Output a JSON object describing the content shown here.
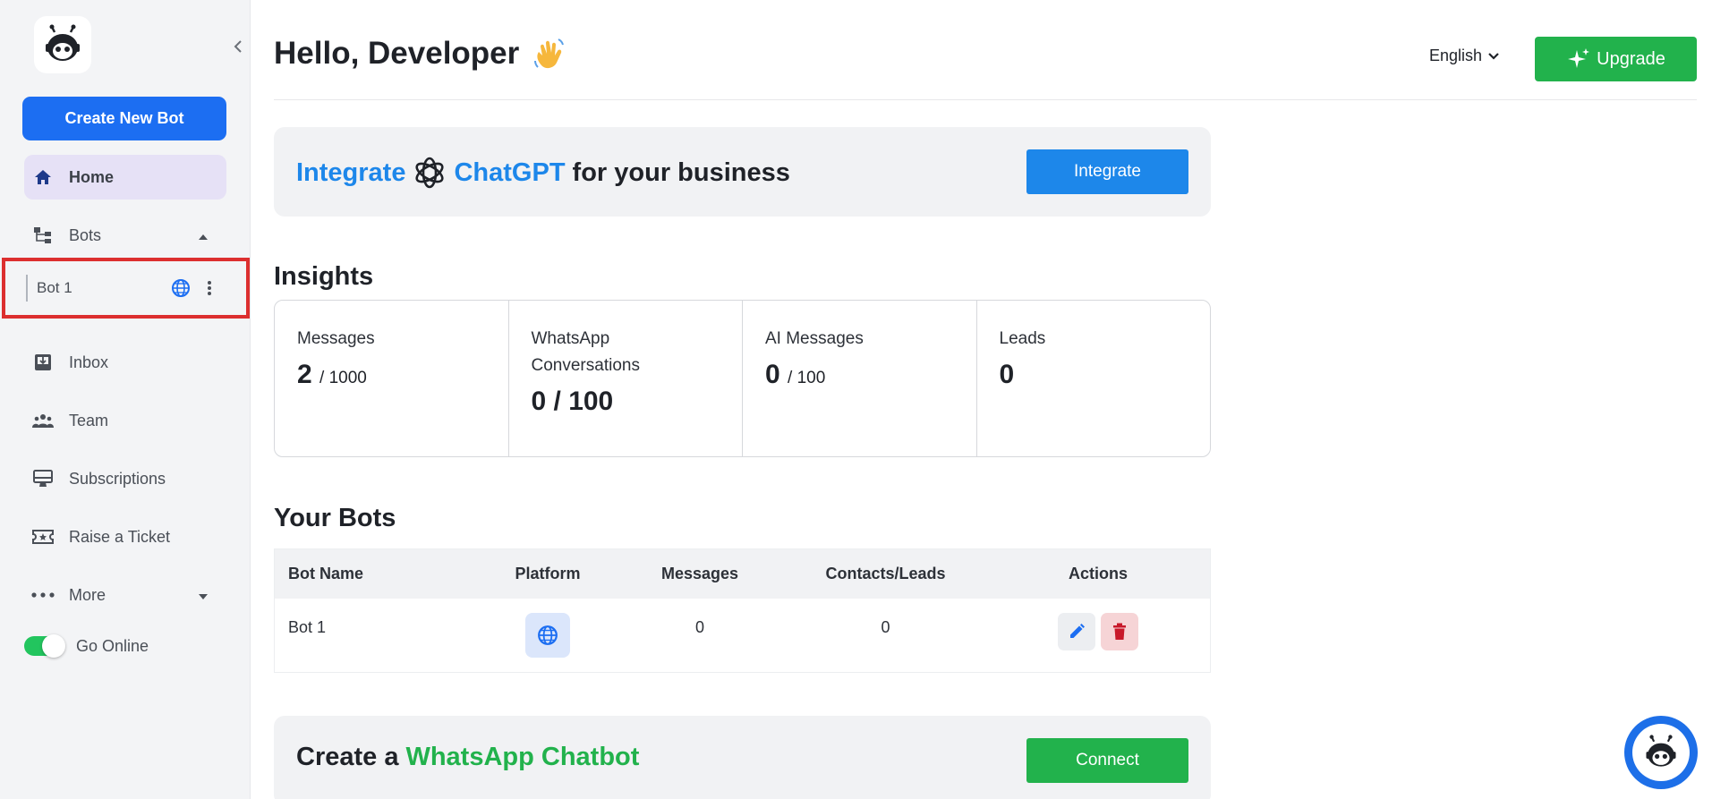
{
  "sidebar": {
    "create_label": "Create New Bot",
    "items": [
      {
        "label": "Home",
        "icon": "home-icon"
      },
      {
        "label": "Bots",
        "icon": "bots-icon"
      },
      {
        "label": "Inbox",
        "icon": "inbox-icon"
      },
      {
        "label": "Team",
        "icon": "team-icon"
      },
      {
        "label": "Subscriptions",
        "icon": "subscriptions-icon"
      },
      {
        "label": "Raise a Ticket",
        "icon": "ticket-icon"
      },
      {
        "label": "More",
        "icon": "more-icon"
      }
    ],
    "bot_entry": {
      "name": "Bot 1"
    },
    "go_online_label": "Go Online",
    "go_online": true
  },
  "header": {
    "greeting": "Hello, Developer",
    "language": "English",
    "upgrade_label": "Upgrade"
  },
  "integrate_banner": {
    "word1": "Integrate",
    "word2": "ChatGPT",
    "word3": "for your business",
    "button_label": "Integrate"
  },
  "insights": {
    "title": "Insights",
    "cards": [
      {
        "label": "Messages",
        "value": "2",
        "limit": "/ 1000"
      },
      {
        "label": "WhatsApp Conversations",
        "value": "0 / 100",
        "limit": ""
      },
      {
        "label": "AI Messages",
        "value": "0",
        "limit": "/ 100"
      },
      {
        "label": "Leads",
        "value": "0",
        "limit": ""
      }
    ]
  },
  "bots_table": {
    "title": "Your Bots",
    "columns": [
      "Bot Name",
      "Platform",
      "Messages",
      "Contacts/Leads",
      "Actions"
    ],
    "rows": [
      {
        "name": "Bot 1",
        "platform": "web",
        "messages": "0",
        "contacts": "0"
      }
    ]
  },
  "whatsapp_banner": {
    "word1": "Create a",
    "word2": "WhatsApp Chatbot",
    "button_label": "Connect"
  },
  "colors": {
    "primary_blue": "#1c6ef2",
    "accent_blue": "#1d87ea",
    "accent_green": "#22b24c",
    "highlight_red": "#dc2f2f"
  }
}
